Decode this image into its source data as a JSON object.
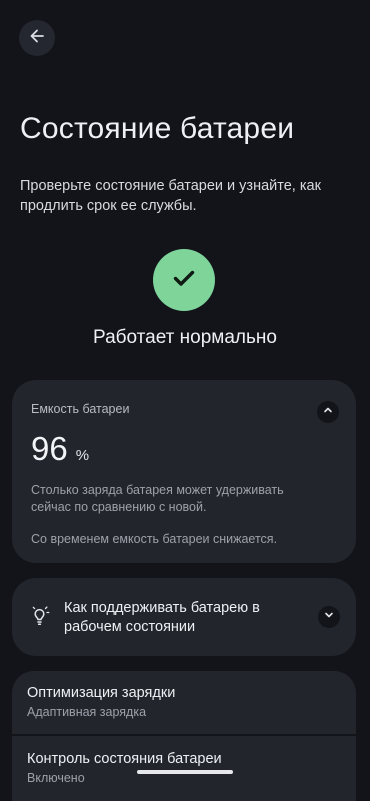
{
  "header": {
    "back_icon": "arrow-left-icon",
    "title": "Состояние батареи",
    "subtitle": "Проверьте состояние батареи и узнайте, как продлить срок ее службы."
  },
  "status": {
    "icon": "check-icon",
    "color": "#7fd49a",
    "text": "Работает нормально"
  },
  "capacity": {
    "label": "Емкость батареи",
    "value": "96",
    "unit": "%",
    "description": "Столько заряда батарея может удерживать сейчас по сравнению с новой.",
    "note": "Со временем емкость батареи снижается.",
    "expanded": true
  },
  "tips": {
    "icon": "lightbulb-icon",
    "label": "Как поддерживать батарею в рабочем состоянии",
    "expanded": false
  },
  "settings": [
    {
      "title": "Оптимизация зарядки",
      "subtitle": "Адаптивная зарядка"
    },
    {
      "title": "Контроль состояния батареи",
      "subtitle": "Включено"
    }
  ]
}
